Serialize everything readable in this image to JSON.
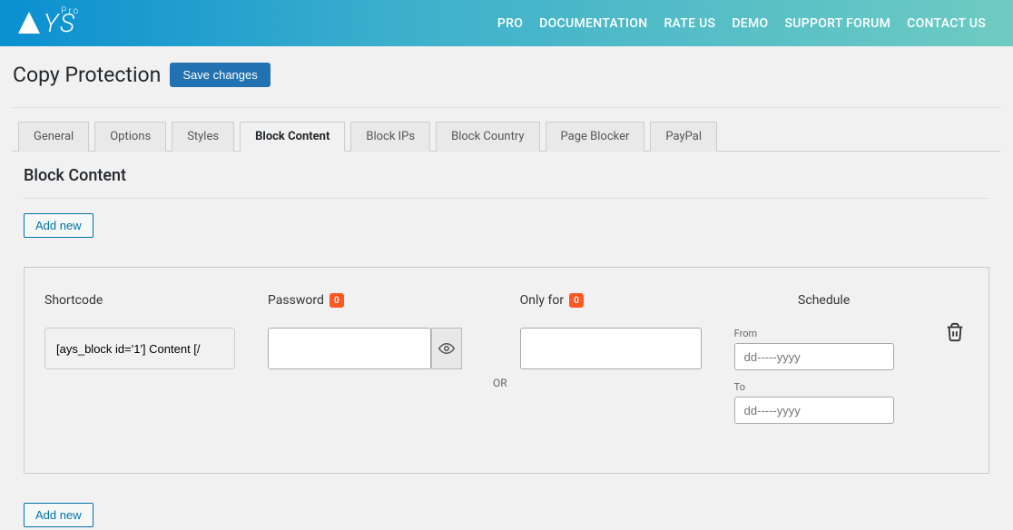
{
  "logo": {
    "text": "YS",
    "superscript": "Pro"
  },
  "nav": {
    "pro": "PRO",
    "documentation": "DOCUMENTATION",
    "rate_us": "RATE US",
    "demo": "DEMO",
    "support_forum": "SUPPORT FORUM",
    "contact_us": "CONTACT US"
  },
  "page": {
    "title": "Copy Protection",
    "save_button": "Save changes"
  },
  "tabs": {
    "general": "General",
    "options": "Options",
    "styles": "Styles",
    "block_content": "Block Content",
    "block_ips": "Block IPs",
    "block_country": "Block Country",
    "page_blocker": "Page Blocker",
    "paypal": "PayPal"
  },
  "section": {
    "title": "Block Content",
    "add_new": "Add new"
  },
  "row": {
    "shortcode": {
      "label": "Shortcode",
      "value": "[ays_block id='1'] Content [/"
    },
    "password": {
      "label": "Password",
      "badge": "0",
      "value": ""
    },
    "or": "OR",
    "only_for": {
      "label": "Only for",
      "badge": "0",
      "value": ""
    },
    "schedule": {
      "label": "Schedule",
      "from_label": "From",
      "from_placeholder": "dd-----yyyy",
      "to_label": "To",
      "to_placeholder": "dd-----yyyy"
    }
  }
}
